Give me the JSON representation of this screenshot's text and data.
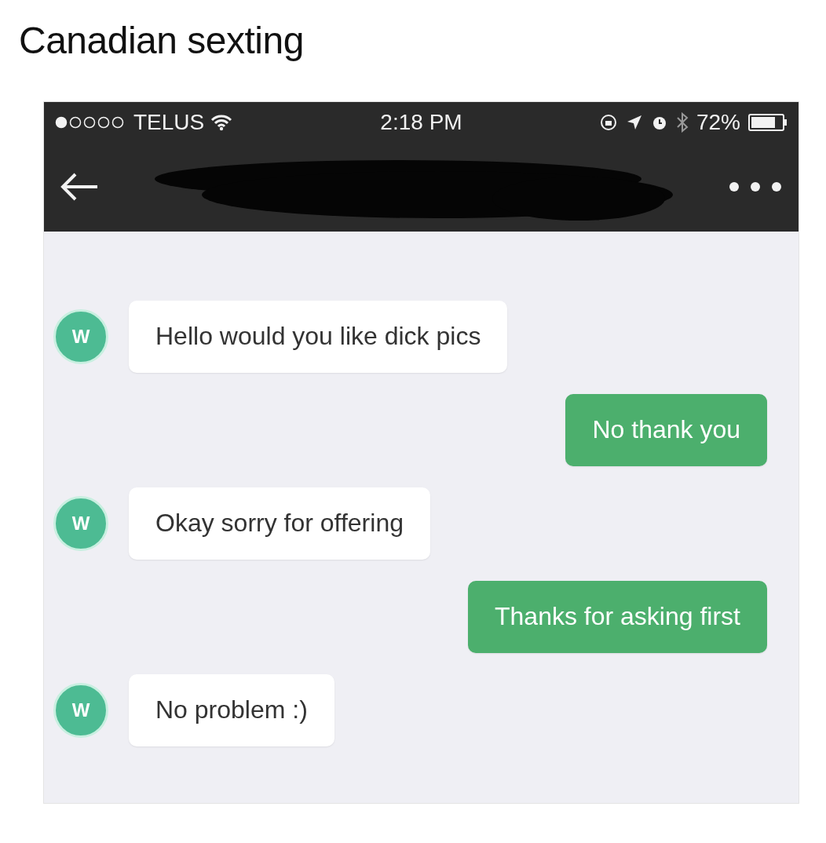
{
  "post_title": "Canadian sexting",
  "status_bar": {
    "carrier": "TELUS",
    "time": "2:18 PM",
    "battery": "72%"
  },
  "messages": [
    {
      "kind": "incoming",
      "avatar": "W",
      "text": "Hello would you like dick pics"
    },
    {
      "kind": "outgoing",
      "text": "No thank you"
    },
    {
      "kind": "incoming",
      "avatar": "W",
      "text": "Okay sorry for offering"
    },
    {
      "kind": "outgoing",
      "text": "Thanks for asking first"
    },
    {
      "kind": "incoming",
      "avatar": "W",
      "text": "No problem :)"
    }
  ]
}
